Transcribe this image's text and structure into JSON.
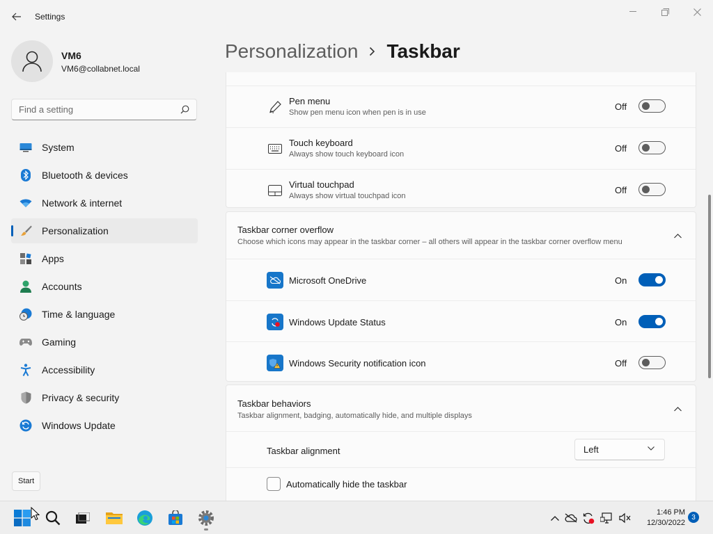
{
  "window": {
    "title": "Settings"
  },
  "profile": {
    "name": "VM6",
    "email": "VM6@collabnet.local"
  },
  "search": {
    "placeholder": "Find a setting"
  },
  "sidebar": {
    "items": [
      {
        "label": "System",
        "icon": "monitor-icon"
      },
      {
        "label": "Bluetooth & devices",
        "icon": "bluetooth-icon"
      },
      {
        "label": "Network & internet",
        "icon": "wifi-icon"
      },
      {
        "label": "Personalization",
        "icon": "brush-icon",
        "active": true
      },
      {
        "label": "Apps",
        "icon": "apps-icon"
      },
      {
        "label": "Accounts",
        "icon": "person-icon"
      },
      {
        "label": "Time & language",
        "icon": "clock-globe-icon"
      },
      {
        "label": "Gaming",
        "icon": "gamepad-icon"
      },
      {
        "label": "Accessibility",
        "icon": "accessibility-icon"
      },
      {
        "label": "Privacy & security",
        "icon": "shield-icon"
      },
      {
        "label": "Windows Update",
        "icon": "update-icon"
      }
    ]
  },
  "start_tooltip": "Start",
  "header": {
    "parent": "Personalization",
    "current": "Taskbar"
  },
  "system_tray_icons": {
    "items": [
      {
        "title": "Pen menu",
        "subtitle": "Show pen menu icon when pen is in use",
        "state": "Off",
        "on": false
      },
      {
        "title": "Touch keyboard",
        "subtitle": "Always show touch keyboard icon",
        "state": "Off",
        "on": false
      },
      {
        "title": "Virtual touchpad",
        "subtitle": "Always show virtual touchpad icon",
        "state": "Off",
        "on": false
      }
    ]
  },
  "corner_overflow": {
    "title": "Taskbar corner overflow",
    "subtitle": "Choose which icons may appear in the taskbar corner – all others will appear in the taskbar corner overflow menu",
    "items": [
      {
        "title": "Microsoft OneDrive",
        "state": "On",
        "on": true
      },
      {
        "title": "Windows Update Status",
        "state": "On",
        "on": true
      },
      {
        "title": "Windows Security notification icon",
        "state": "Off",
        "on": false
      }
    ]
  },
  "behaviors": {
    "title": "Taskbar behaviors",
    "subtitle": "Taskbar alignment, badging, automatically hide, and multiple displays",
    "alignment_label": "Taskbar alignment",
    "alignment_value": "Left",
    "autohide_label": "Automatically hide the taskbar",
    "autohide_checked": false
  },
  "taskbar": {
    "time": "1:46 PM",
    "date": "12/30/2022",
    "notification_count": "3"
  },
  "colors": {
    "accent": "#005fb8",
    "background": "#f3f3f3",
    "card": "#fbfbfb"
  }
}
